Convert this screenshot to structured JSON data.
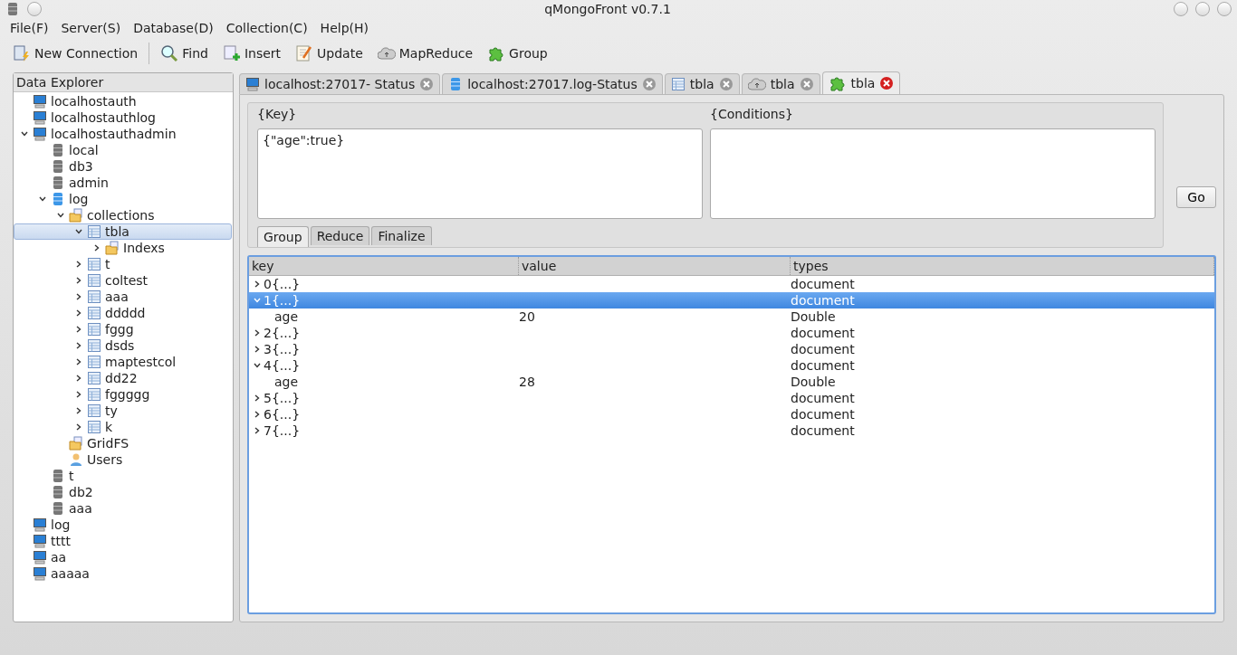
{
  "window": {
    "title": "qMongoFront v0.7.1"
  },
  "menu": [
    "File(F)",
    "Server(S)",
    "Database(D)",
    "Collection(C)",
    "Help(H)"
  ],
  "toolbar": [
    {
      "kind": "connect",
      "label": "New Connection"
    },
    {
      "kind": "find",
      "label": "Find"
    },
    {
      "kind": "insert",
      "label": "Insert"
    },
    {
      "kind": "update",
      "label": "Update"
    },
    {
      "kind": "mapreduce",
      "label": "MapReduce"
    },
    {
      "kind": "group",
      "label": "Group"
    }
  ],
  "explorer": {
    "title": "Data Explorer",
    "items": [
      {
        "kind": "server",
        "label": "localhostauth",
        "expanded": false,
        "selected": false
      },
      {
        "kind": "server",
        "label": "localhostauthlog",
        "expanded": false,
        "selected": false
      },
      {
        "kind": "server",
        "label": "localhostauthadmin",
        "expanded": true,
        "selected": false,
        "children": [
          {
            "kind": "db",
            "label": "local",
            "expanded": false,
            "selected": false
          },
          {
            "kind": "db",
            "label": "db3",
            "expanded": false,
            "selected": false
          },
          {
            "kind": "db",
            "label": "admin",
            "expanded": false,
            "selected": false
          },
          {
            "kind": "dbopen",
            "label": "log",
            "expanded": true,
            "selected": false,
            "children": [
              {
                "kind": "folder",
                "label": "collections",
                "expanded": true,
                "selected": false,
                "children": [
                  {
                    "kind": "collection",
                    "label": "tbla",
                    "expanded": true,
                    "selected": true,
                    "children": [
                      {
                        "kind": "folder",
                        "label": "Indexs",
                        "expanded": false,
                        "selected": false,
                        "has_children": true
                      }
                    ]
                  },
                  {
                    "kind": "collection",
                    "label": "t",
                    "expanded": false,
                    "selected": false,
                    "has_children": true
                  },
                  {
                    "kind": "collection",
                    "label": "coltest",
                    "expanded": false,
                    "selected": false,
                    "has_children": true
                  },
                  {
                    "kind": "collection",
                    "label": "aaa",
                    "expanded": false,
                    "selected": false,
                    "has_children": true
                  },
                  {
                    "kind": "collection",
                    "label": "ddddd",
                    "expanded": false,
                    "selected": false,
                    "has_children": true
                  },
                  {
                    "kind": "collection",
                    "label": "fggg",
                    "expanded": false,
                    "selected": false,
                    "has_children": true
                  },
                  {
                    "kind": "collection",
                    "label": "dsds",
                    "expanded": false,
                    "selected": false,
                    "has_children": true
                  },
                  {
                    "kind": "collection",
                    "label": "maptestcol",
                    "expanded": false,
                    "selected": false,
                    "has_children": true
                  },
                  {
                    "kind": "collection",
                    "label": "dd22",
                    "expanded": false,
                    "selected": false,
                    "has_children": true
                  },
                  {
                    "kind": "collection",
                    "label": "fggggg",
                    "expanded": false,
                    "selected": false,
                    "has_children": true
                  },
                  {
                    "kind": "collection",
                    "label": "ty",
                    "expanded": false,
                    "selected": false,
                    "has_children": true
                  },
                  {
                    "kind": "collection",
                    "label": "k",
                    "expanded": false,
                    "selected": false,
                    "has_children": true
                  }
                ]
              },
              {
                "kind": "folder",
                "label": "GridFS",
                "expanded": false,
                "selected": false
              },
              {
                "kind": "users",
                "label": "Users",
                "expanded": false,
                "selected": false
              }
            ]
          },
          {
            "kind": "db",
            "label": "t",
            "expanded": false,
            "selected": false
          },
          {
            "kind": "db",
            "label": "db2",
            "expanded": false,
            "selected": false
          },
          {
            "kind": "db",
            "label": "aaa",
            "expanded": false,
            "selected": false
          }
        ]
      },
      {
        "kind": "server",
        "label": "log",
        "expanded": false,
        "selected": false
      },
      {
        "kind": "server",
        "label": "tttt",
        "expanded": false,
        "selected": false
      },
      {
        "kind": "server",
        "label": "aa",
        "expanded": false,
        "selected": false
      },
      {
        "kind": "server",
        "label": "aaaaa",
        "expanded": false,
        "selected": false
      }
    ]
  },
  "tabs": [
    {
      "kind": "server",
      "label": "localhost:27017- Status",
      "selected": false
    },
    {
      "kind": "dbopen",
      "label": "localhost:27017.log-Status",
      "selected": false
    },
    {
      "kind": "collection",
      "label": "tbla",
      "selected": false
    },
    {
      "kind": "mapreduce",
      "label": "tbla",
      "selected": false
    },
    {
      "kind": "group",
      "label": "tbla",
      "selected": true
    }
  ],
  "group_form": {
    "key_label": "{Key}",
    "key_value": "{\"age\":true}",
    "conditions_label": "{Conditions}",
    "go_button": "Go",
    "subtabs": [
      {
        "label": "Group",
        "selected": true
      },
      {
        "label": "Reduce",
        "selected": false
      },
      {
        "label": "Finalize",
        "selected": false
      }
    ]
  },
  "results": {
    "columns": [
      "key",
      "value",
      "types"
    ],
    "rows": [
      {
        "key": "0{...}",
        "value": "",
        "type": "document",
        "expanded": false,
        "selected": false
      },
      {
        "key": "1{...}",
        "value": "",
        "type": "document",
        "expanded": true,
        "selected": true,
        "children": [
          {
            "key": "age",
            "value": "20",
            "type": "Double",
            "selected": false
          }
        ]
      },
      {
        "key": "2{...}",
        "value": "",
        "type": "document",
        "expanded": false,
        "selected": false
      },
      {
        "key": "3{...}",
        "value": "",
        "type": "document",
        "expanded": false,
        "selected": false
      },
      {
        "key": "4{...}",
        "value": "",
        "type": "document",
        "expanded": true,
        "selected": false,
        "children": [
          {
            "key": "age",
            "value": "28",
            "type": "Double",
            "selected": false
          }
        ]
      },
      {
        "key": "5{...}",
        "value": "",
        "type": "document",
        "expanded": false,
        "selected": false
      },
      {
        "key": "6{...}",
        "value": "",
        "type": "document",
        "expanded": false,
        "selected": false
      },
      {
        "key": "7{...}",
        "value": "",
        "type": "document",
        "expanded": false,
        "selected": false
      }
    ]
  }
}
